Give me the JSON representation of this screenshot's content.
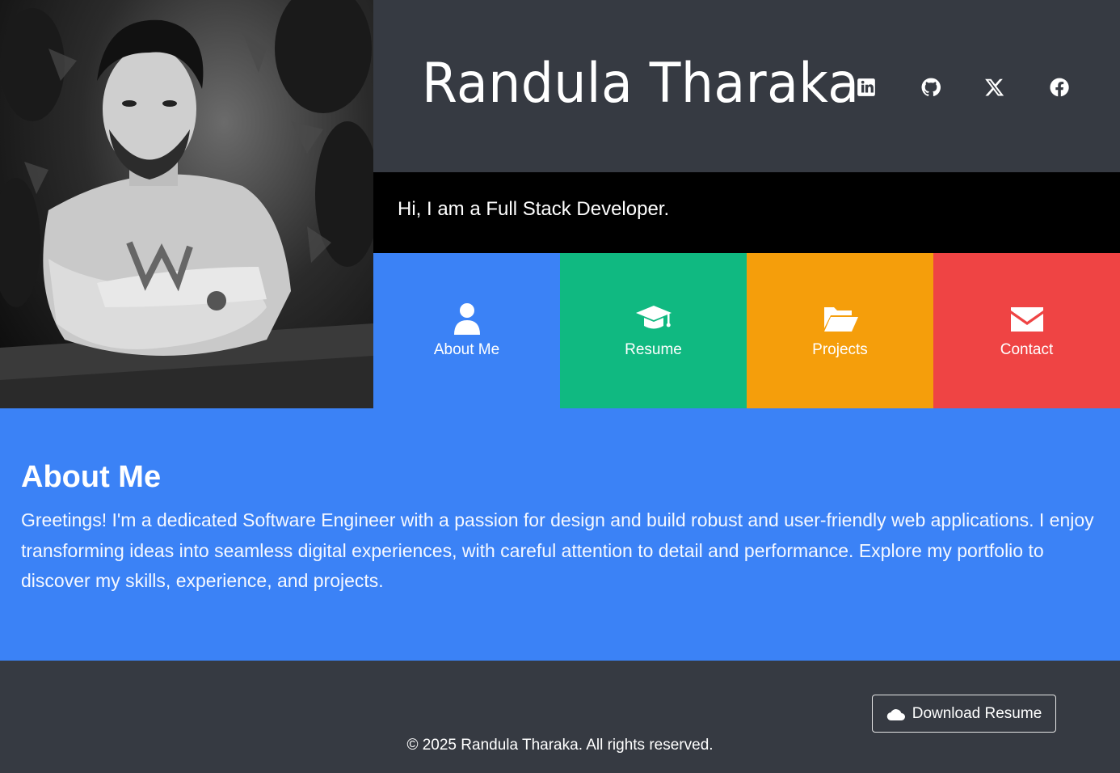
{
  "header": {
    "name": "Randula Tharaka",
    "tagline": "Hi, I am a Full Stack Developer.",
    "social": [
      {
        "icon": "linkedin-icon"
      },
      {
        "icon": "github-icon"
      },
      {
        "icon": "x-twitter-icon"
      },
      {
        "icon": "facebook-icon"
      }
    ]
  },
  "nav": {
    "tiles": [
      {
        "label": "About Me",
        "icon": "user-icon",
        "color": "#3b82f6"
      },
      {
        "label": "Resume",
        "icon": "graduation-cap-icon",
        "color": "#10b981"
      },
      {
        "label": "Projects",
        "icon": "folder-open-icon",
        "color": "#f59e0b"
      },
      {
        "label": "Contact",
        "icon": "envelope-icon",
        "color": "#ef4444"
      }
    ]
  },
  "about": {
    "heading": "About Me",
    "body": "Greetings! I'm a dedicated Software Engineer with a passion for design and build robust and user-friendly web applications. I enjoy transforming ideas into seamless digital experiences, with careful attention to detail and performance. Explore my portfolio to discover my skills, experience, and projects."
  },
  "footer": {
    "download_label": "Download Resume",
    "copyright": "© 2025 Randula Tharaka. All rights reserved."
  },
  "colors": {
    "dark_bg": "#363a42",
    "black_bar": "#000000",
    "about_bg": "#3b82f6"
  }
}
